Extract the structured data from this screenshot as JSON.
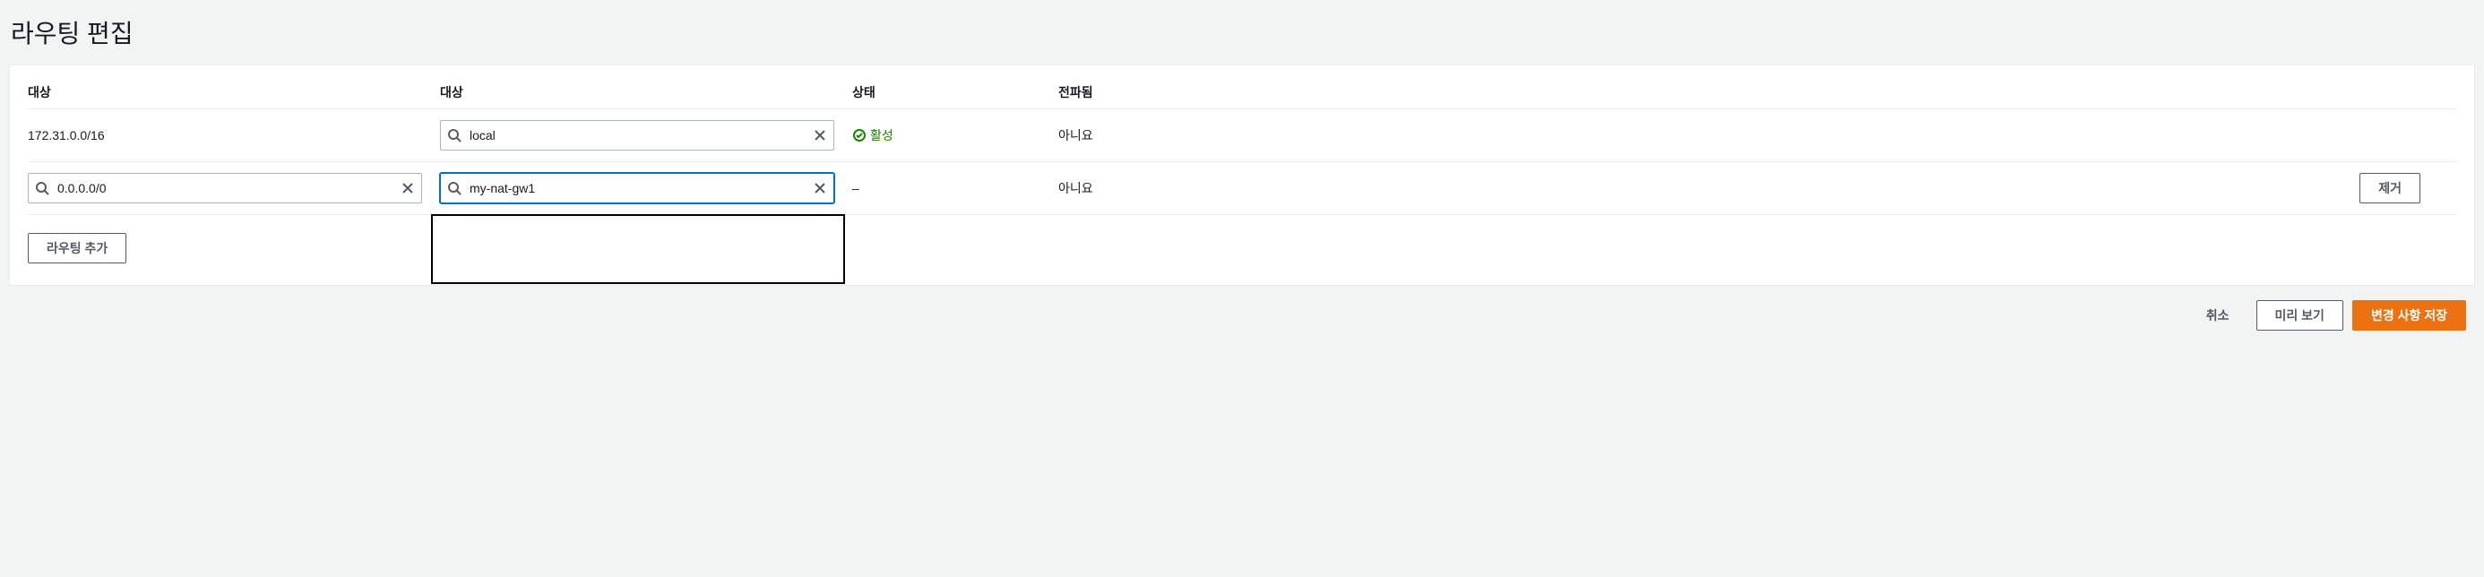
{
  "page": {
    "title": "라우팅 편집"
  },
  "table": {
    "headers": {
      "destination1": "대상",
      "destination2": "대상",
      "status": "상태",
      "propagated": "전파됨"
    },
    "rows": [
      {
        "destination": "172.31.0.0/16",
        "target": "local",
        "status": "활성",
        "status_type": "active",
        "propagated": "아니요",
        "removable": false,
        "destination_editable": false
      },
      {
        "destination": "0.0.0.0/0",
        "target": "my-nat-gw1",
        "status": "–",
        "status_type": "none",
        "propagated": "아니요",
        "removable": true,
        "destination_editable": true,
        "target_focused": true
      }
    ]
  },
  "buttons": {
    "add_route": "라우팅 추가",
    "remove": "제거",
    "cancel": "취소",
    "preview": "미리 보기",
    "save": "변경 사항 저장"
  }
}
